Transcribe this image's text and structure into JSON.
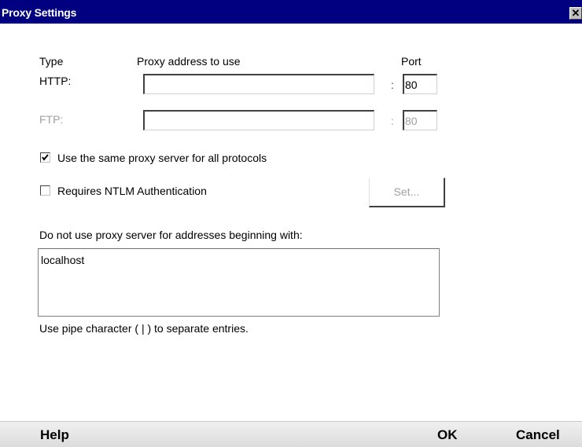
{
  "window": {
    "title": "Proxy Settings",
    "close_glyph": "✕"
  },
  "headers": {
    "type": "Type",
    "address": "Proxy address to use",
    "port": "Port"
  },
  "protocols": {
    "http": {
      "label": "HTTP:",
      "address": "",
      "port": "80",
      "enabled": true
    },
    "ftp": {
      "label": "FTP:",
      "address": "",
      "port": "80",
      "enabled": false
    }
  },
  "colon": ":",
  "options": {
    "same_proxy": {
      "label": "Use the same proxy server for all protocols",
      "checked": true
    },
    "ntlm": {
      "label": "Requires NTLM Authentication",
      "checked": false
    },
    "set_button": "Set..."
  },
  "exclusions": {
    "label": "Do not use proxy server for addresses beginning with:",
    "value": "localhost",
    "hint": "Use pipe character ( | ) to separate entries."
  },
  "footer": {
    "help": "Help",
    "ok": "OK",
    "cancel": "Cancel"
  },
  "icons": {
    "close": "close-icon",
    "checkmark": "checkmark-icon"
  }
}
